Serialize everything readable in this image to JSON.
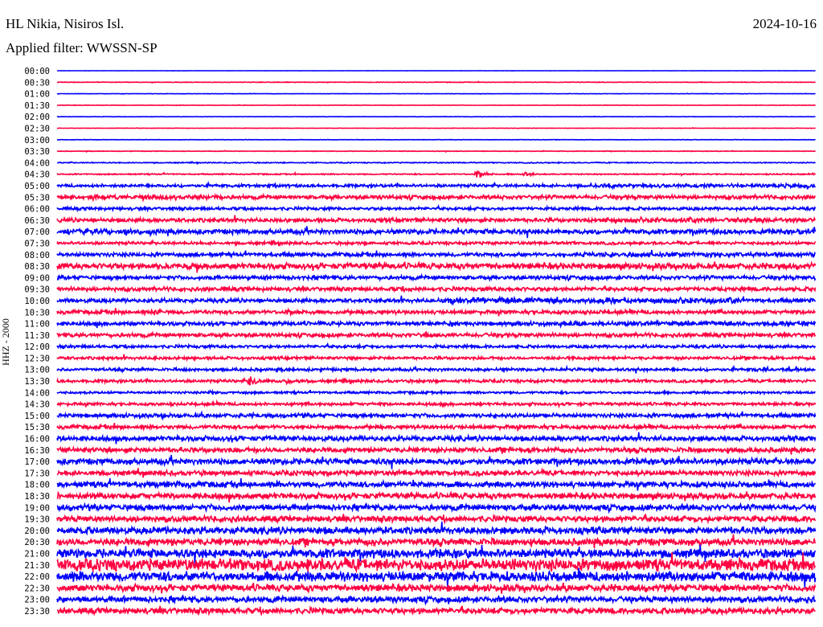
{
  "header": {
    "station": "HL Nikia, Nisiros Isl.",
    "filter": "Applied filter: WWSSN-SP",
    "date": "2024-10-16"
  },
  "chart_data": {
    "type": "line",
    "title": "HL Nikia, Nisiros Isl.",
    "subtitle": "Applied filter: WWSSN-SP",
    "ylabel": "HHZ - 2000",
    "xlabel": "",
    "row_minutes": 30,
    "colors": {
      "even": "#0000ff",
      "odd": "#ff0040"
    },
    "rows": [
      {
        "label": "00:00",
        "noise": 0.1,
        "events": []
      },
      {
        "label": "00:30",
        "noise": 0.3,
        "events": []
      },
      {
        "label": "01:00",
        "noise": 0.2,
        "events": []
      },
      {
        "label": "01:30",
        "noise": 0.2,
        "events": []
      },
      {
        "label": "02:00",
        "noise": 0.2,
        "events": []
      },
      {
        "label": "02:30",
        "noise": 0.2,
        "events": []
      },
      {
        "label": "03:00",
        "noise": 0.2,
        "events": []
      },
      {
        "label": "03:30",
        "noise": 0.3,
        "events": []
      },
      {
        "label": "04:00",
        "noise": 0.5,
        "events": []
      },
      {
        "label": "04:30",
        "noise": 0.6,
        "events": [
          [
            16.5,
            1.2,
            6
          ],
          [
            18.4,
            0.8,
            5
          ]
        ]
      },
      {
        "label": "05:00",
        "noise": 1.5,
        "events": [
          [
            2.2,
            0.5,
            3
          ],
          [
            21,
            9,
            2.5
          ]
        ]
      },
      {
        "label": "05:30",
        "noise": 2,
        "events": [
          [
            1,
            5.5,
            3.5
          ]
        ]
      },
      {
        "label": "06:00",
        "noise": 1.5,
        "events": [
          [
            11,
            1,
            2.5
          ]
        ]
      },
      {
        "label": "06:30",
        "noise": 2,
        "events": [
          [
            21,
            9,
            3
          ]
        ]
      },
      {
        "label": "07:00",
        "noise": 2.5,
        "events": [
          [
            0,
            4,
            4
          ]
        ]
      },
      {
        "label": "07:30",
        "noise": 1.5,
        "events": []
      },
      {
        "label": "08:00",
        "noise": 2,
        "events": [
          [
            20,
            10,
            3
          ]
        ]
      },
      {
        "label": "08:30",
        "noise": 3,
        "events": [
          [
            4,
            1.5,
            4
          ]
        ]
      },
      {
        "label": "09:00",
        "noise": 2,
        "events": [
          [
            6,
            1,
            3
          ]
        ]
      },
      {
        "label": "09:30",
        "noise": 2,
        "events": []
      },
      {
        "label": "10:00",
        "noise": 2,
        "events": [
          [
            15,
            12,
            4
          ]
        ]
      },
      {
        "label": "10:30",
        "noise": 2,
        "events": [
          [
            3.8,
            1.2,
            6
          ],
          [
            9,
            1.2,
            4.5
          ]
        ]
      },
      {
        "label": "11:00",
        "noise": 2,
        "events": [
          [
            15.5,
            1,
            4.5
          ],
          [
            19.5,
            10,
            3
          ]
        ]
      },
      {
        "label": "11:30",
        "noise": 2,
        "events": [
          [
            14.5,
            1,
            4
          ]
        ]
      },
      {
        "label": "12:00",
        "noise": 1.5,
        "events": []
      },
      {
        "label": "12:30",
        "noise": 1.5,
        "events": []
      },
      {
        "label": "13:00",
        "noise": 1.5,
        "events": [
          [
            27.5,
            2,
            2.5
          ]
        ]
      },
      {
        "label": "13:30",
        "noise": 1.5,
        "events": [
          [
            7.5,
            1.3,
            7
          ],
          [
            9,
            1.1,
            5.5
          ]
        ]
      },
      {
        "label": "14:00",
        "noise": 1.2,
        "events": [
          [
            6,
            0.8,
            3.5
          ]
        ]
      },
      {
        "label": "14:30",
        "noise": 1.5,
        "events": []
      },
      {
        "label": "15:00",
        "noise": 2,
        "events": [
          [
            16.5,
            1.5,
            3
          ]
        ]
      },
      {
        "label": "15:30",
        "noise": 2,
        "events": []
      },
      {
        "label": "16:00",
        "noise": 2.5,
        "events": [
          [
            9.5,
            0.5,
            4
          ]
        ]
      },
      {
        "label": "16:30",
        "noise": 2.5,
        "events": []
      },
      {
        "label": "17:00",
        "noise": 3,
        "events": []
      },
      {
        "label": "17:30",
        "noise": 2.5,
        "events": []
      },
      {
        "label": "18:00",
        "noise": 3,
        "events": [
          [
            14,
            0.8,
            4
          ]
        ]
      },
      {
        "label": "18:30",
        "noise": 3,
        "events": [
          [
            2.4,
            0.8,
            4.5
          ]
        ]
      },
      {
        "label": "19:00",
        "noise": 3,
        "events": []
      },
      {
        "label": "19:30",
        "noise": 3,
        "events": []
      },
      {
        "label": "20:00",
        "noise": 3.5,
        "events": []
      },
      {
        "label": "20:30",
        "noise": 3.5,
        "events": []
      },
      {
        "label": "21:00",
        "noise": 4.5,
        "events": []
      },
      {
        "label": "21:30",
        "noise": 6,
        "events": []
      },
      {
        "label": "22:00",
        "noise": 5,
        "events": []
      },
      {
        "label": "22:30",
        "noise": 3.5,
        "events": []
      },
      {
        "label": "23:00",
        "noise": 3,
        "events": []
      },
      {
        "label": "23:30",
        "noise": 3,
        "events": []
      }
    ]
  }
}
